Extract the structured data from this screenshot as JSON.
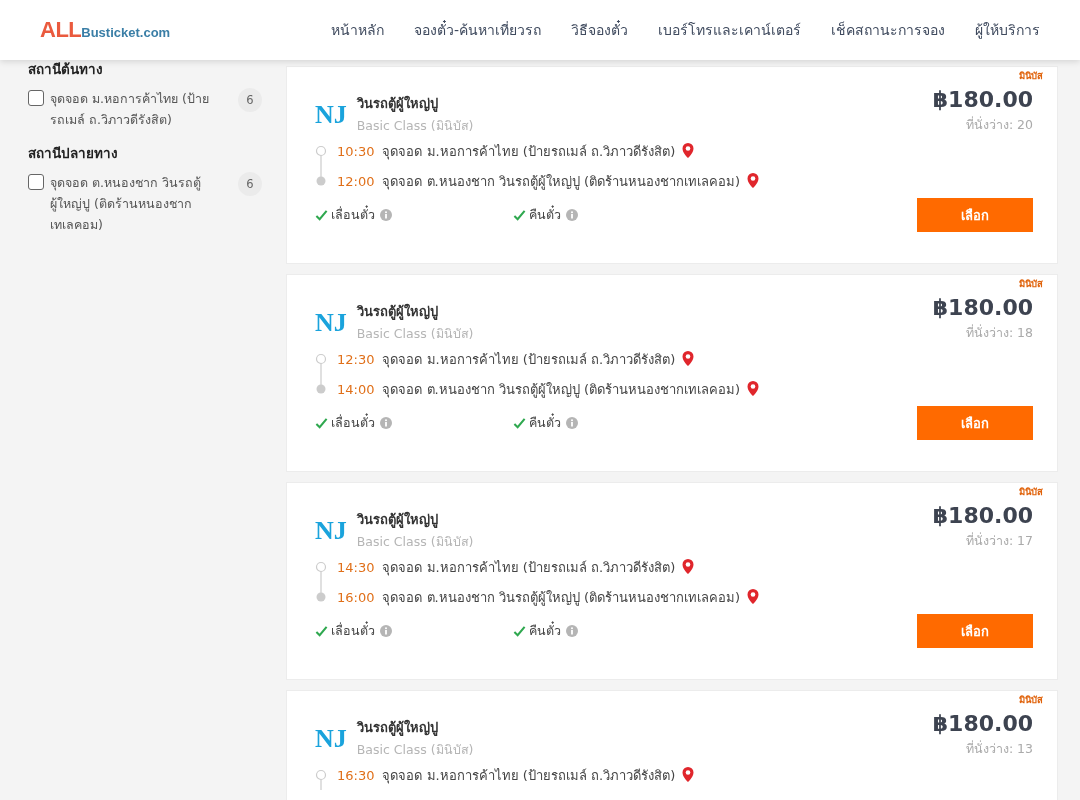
{
  "header": {
    "logo": {
      "main": "ALL",
      "sub": "Busticket.com"
    },
    "nav": [
      {
        "label": "หน้าหลัก",
        "selected": false
      },
      {
        "label": "จองตั๋ว-ค้นหาเที่ยวรถ",
        "selected": false
      },
      {
        "label": "วิธีจองตั๋ว",
        "selected": false
      },
      {
        "label": "เบอร์โทรและเคาน์เตอร์",
        "selected": false
      },
      {
        "label": "เช็คสถานะการจอง",
        "selected": false
      },
      {
        "label": "ผู้ให้บริการ",
        "selected": false
      }
    ]
  },
  "filters": [
    {
      "title": "สถานีต้นทาง",
      "items": [
        {
          "label": "จุดจอด ม.หอการค้าไทย (ป้ายรถเมล์ ถ.วิภาวดีรังสิต)",
          "count": "6",
          "checked": false
        }
      ]
    },
    {
      "title": "สถานีปลายทาง",
      "items": [
        {
          "label": "จุดจอด ต.หนองชาก วินรถตู้ผู้ใหญ่ปู (ติดร้านหนองชากเทเลคอม)",
          "count": "6",
          "checked": false
        }
      ]
    }
  ],
  "trips": [
    {
      "badge": "มินิบัส",
      "logo": "NJ",
      "operator": "วินรถตู้ผู้ใหญ่ปู",
      "class": "Basic Class (มินิบัส)",
      "price": "฿180.00",
      "seats": "ที่นั่งว่าง: 20",
      "stops": [
        {
          "kind": "origin",
          "time": "10:30",
          "place": "จุดจอด ม.หอการค้าไทย (ป้ายรถเมล์ ถ.วิภาวดีรังสิต)"
        },
        {
          "kind": "destination",
          "time": "12:00",
          "place": "จุดจอด ต.หนองชาก วินรถตู้ผู้ใหญ่ปู (ติดร้านหนองชากเทเลคอม)"
        }
      ],
      "features": [
        {
          "label": "เลื่อนตั๋ว",
          "available": true
        },
        {
          "label": "คืนตั๋ว",
          "available": true
        }
      ],
      "button": "เลือก"
    },
    {
      "badge": "มินิบัส",
      "logo": "NJ",
      "operator": "วินรถตู้ผู้ใหญ่ปู",
      "class": "Basic Class (มินิบัส)",
      "price": "฿180.00",
      "seats": "ที่นั่งว่าง: 18",
      "stops": [
        {
          "kind": "origin",
          "time": "12:30",
          "place": "จุดจอด ม.หอการค้าไทย (ป้ายรถเมล์ ถ.วิภาวดีรังสิต)"
        },
        {
          "kind": "destination",
          "time": "14:00",
          "place": "จุดจอด ต.หนองชาก วินรถตู้ผู้ใหญ่ปู (ติดร้านหนองชากเทเลคอม)"
        }
      ],
      "features": [
        {
          "label": "เลื่อนตั๋ว",
          "available": true
        },
        {
          "label": "คืนตั๋ว",
          "available": true
        }
      ],
      "button": "เลือก"
    },
    {
      "badge": "มินิบัส",
      "logo": "NJ",
      "operator": "วินรถตู้ผู้ใหญ่ปู",
      "class": "Basic Class (มินิบัส)",
      "price": "฿180.00",
      "seats": "ที่นั่งว่าง: 17",
      "stops": [
        {
          "kind": "origin",
          "time": "14:30",
          "place": "จุดจอด ม.หอการค้าไทย (ป้ายรถเมล์ ถ.วิภาวดีรังสิต)"
        },
        {
          "kind": "destination",
          "time": "16:00",
          "place": "จุดจอด ต.หนองชาก วินรถตู้ผู้ใหญ่ปู (ติดร้านหนองชากเทเลคอม)"
        }
      ],
      "features": [
        {
          "label": "เลื่อนตั๋ว",
          "available": true
        },
        {
          "label": "คืนตั๋ว",
          "available": true
        }
      ],
      "button": "เลือก"
    },
    {
      "badge": "มินิบัส",
      "logo": "NJ",
      "operator": "วินรถตู้ผู้ใหญ่ปู",
      "class": "Basic Class (มินิบัส)",
      "price": "฿180.00",
      "seats": "ที่นั่งว่าง: 13",
      "stops": [
        {
          "kind": "origin",
          "time": "16:30",
          "place": "จุดจอด ม.หอการค้าไทย (ป้ายรถเมล์ ถ.วิภาวดีรังสิต)"
        }
      ]
    }
  ]
}
